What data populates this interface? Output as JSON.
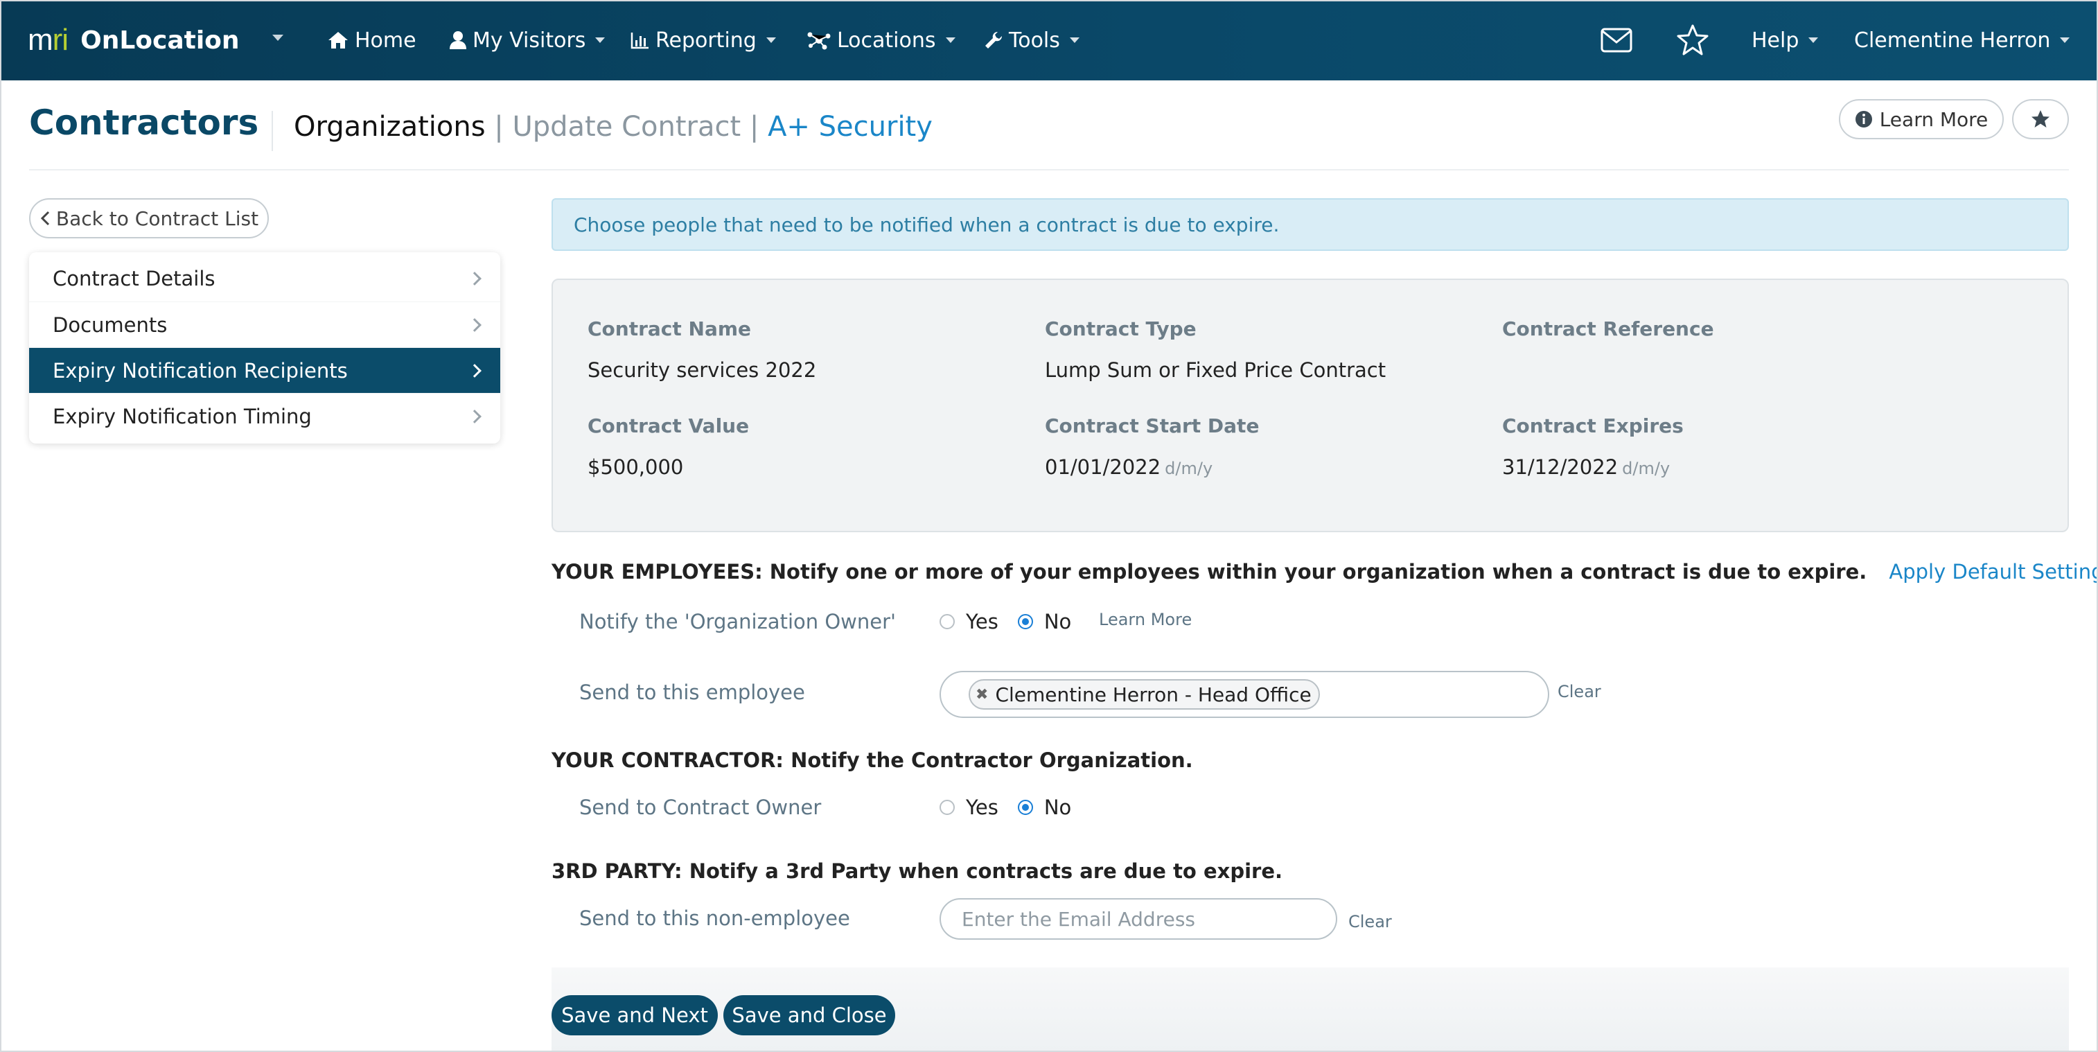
{
  "nav": {
    "brand_mark_m": "m",
    "brand_mark_ri": "ri",
    "brand_name": "OnLocation",
    "items": [
      {
        "label": "Home",
        "icon": "home-icon",
        "has_caret": false
      },
      {
        "label": "My Visitors",
        "icon": "user-icon",
        "has_caret": true
      },
      {
        "label": "Reporting",
        "icon": "bar-chart-icon",
        "has_caret": true
      },
      {
        "label": "Locations",
        "icon": "network-icon",
        "has_caret": true
      },
      {
        "label": "Tools",
        "icon": "wrench-icon",
        "has_caret": true
      }
    ],
    "help_label": "Help",
    "user_label": "Clementine Herron",
    "accent_color": "#b6cf33",
    "nav_bg_color": "#0a4868"
  },
  "header": {
    "title": "Contractors",
    "crumb_org": "Organizations",
    "crumb_sep": "|",
    "crumb_update": "Update Contract",
    "crumb_company": "A+ Security",
    "learn_more_label": "Learn More"
  },
  "sidebar": {
    "back_label": "Back to Contract List",
    "items": [
      {
        "label": "Contract Details",
        "active": false
      },
      {
        "label": "Documents",
        "active": false
      },
      {
        "label": "Expiry Notification Recipients",
        "active": true
      },
      {
        "label": "Expiry Notification Timing",
        "active": false
      }
    ]
  },
  "main": {
    "alert_text": "Choose people that need to be notified when a contract is due to expire.",
    "summary": {
      "contract_name_label": "Contract Name",
      "contract_name": "Security services 2022",
      "contract_type_label": "Contract Type",
      "contract_type": "Lump Sum or Fixed Price Contract",
      "contract_reference_label": "Contract Reference",
      "contract_reference": "",
      "contract_value_label": "Contract Value",
      "contract_value": "$500,000",
      "start_date_label": "Contract Start Date",
      "start_date": "01/01/2022",
      "expires_label": "Contract Expires",
      "expires": "31/12/2022",
      "date_format": "d/m/y"
    },
    "employees": {
      "heading": "YOUR EMPLOYEES: Notify one or more of your employees within your organization when a contract is due to expire.",
      "apply_default_label": "Apply Default Settings",
      "notify_owner_label": "Notify the 'Organization Owner'",
      "yes_label": "Yes",
      "no_label": "No",
      "selected": "No",
      "learn_more_label": "Learn More",
      "send_employee_label": "Send to this employee",
      "employee_tag": "Clementine Herron - Head Office",
      "clear_label": "Clear"
    },
    "contractor": {
      "heading": "YOUR CONTRACTOR: Notify the Contractor Organization.",
      "send_owner_label": "Send to Contract Owner",
      "yes_label": "Yes",
      "no_label": "No",
      "selected": "No"
    },
    "third_party": {
      "heading": "3RD PARTY: Notify a 3rd Party when contracts are due to expire.",
      "send_label": "Send to this non-employee",
      "email_value": "",
      "email_placeholder": "Enter the Email Address",
      "clear_label": "Clear"
    },
    "actions": {
      "save_next_label": "Save and Next",
      "save_close_label": "Save and Close"
    }
  }
}
